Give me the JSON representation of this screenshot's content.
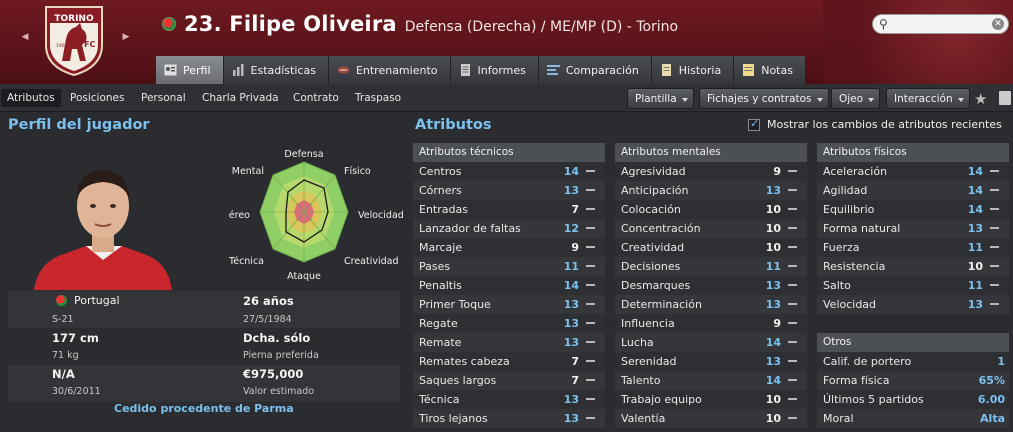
{
  "header": {
    "player_name": "23. Filipe Oliveira",
    "player_role": "Defensa (Derecha) / ME/MP (D) - Torino",
    "crest_name": "TORINO",
    "crest_letters": "FC",
    "crest_year": "1906",
    "search_placeholder": ""
  },
  "tabs": [
    {
      "label": "Perfil",
      "icon": "profile-icon"
    },
    {
      "label": "Estadísticas",
      "icon": "stats-icon"
    },
    {
      "label": "Entrenamiento",
      "icon": "ball-icon"
    },
    {
      "label": "Informes",
      "icon": "report-icon"
    },
    {
      "label": "Comparación",
      "icon": "compare-icon"
    },
    {
      "label": "Historia",
      "icon": "history-icon"
    },
    {
      "label": "Notas",
      "icon": "notes-icon"
    }
  ],
  "subtabs": [
    "Atributos",
    "Posiciones",
    "Personal",
    "Charla Privada",
    "Contrato",
    "Traspaso"
  ],
  "dropdowns": [
    "Plantilla",
    "Fichajes y contratos",
    "Ojeo",
    "Interacción"
  ],
  "profile": {
    "title": "Perfil del jugador",
    "radar_labels": {
      "defensa": "Defensa",
      "fisico": "Físico",
      "velocidad": "Velocidad",
      "creatividad": "Creatividad",
      "ataque": "Ataque",
      "tecnica": "Técnica",
      "juego_aereo": "Juego aéreo",
      "mental": "Mental"
    },
    "nationality": "Portugal",
    "age": "26 años",
    "youth": "S-21",
    "dob": "27/5/1984",
    "height": "177 cm",
    "foot": "Dcha. sólo",
    "weight": "71 kg",
    "foot_label": "Pierna preferida",
    "contract": "N/A",
    "value": "€975,000",
    "contract_date": "30/6/2011",
    "value_label": "Valor estimado",
    "loan": "Cedido procedente de Parma"
  },
  "attributes": {
    "title": "Atributos",
    "show_changes": "Mostrar los cambios de atributos recientes",
    "technical": {
      "title": "Atributos técnicos",
      "items": [
        {
          "name": "Centros",
          "value": "14"
        },
        {
          "name": "Córners",
          "value": "13"
        },
        {
          "name": "Entradas",
          "value": "7"
        },
        {
          "name": "Lanzador de faltas",
          "value": "12"
        },
        {
          "name": "Marcaje",
          "value": "9"
        },
        {
          "name": "Pases",
          "value": "11"
        },
        {
          "name": "Penaltis",
          "value": "14"
        },
        {
          "name": "Primer Toque",
          "value": "13"
        },
        {
          "name": "Regate",
          "value": "13"
        },
        {
          "name": "Remate",
          "value": "13"
        },
        {
          "name": "Remates cabeza",
          "value": "7"
        },
        {
          "name": "Saques largos",
          "value": "7"
        },
        {
          "name": "Técnica",
          "value": "13"
        },
        {
          "name": "Tiros lejanos",
          "value": "13"
        }
      ]
    },
    "mental": {
      "title": "Atributos mentales",
      "items": [
        {
          "name": "Agresividad",
          "value": "9"
        },
        {
          "name": "Anticipación",
          "value": "13"
        },
        {
          "name": "Colocación",
          "value": "10"
        },
        {
          "name": "Concentración",
          "value": "10"
        },
        {
          "name": "Creatividad",
          "value": "10"
        },
        {
          "name": "Decisiones",
          "value": "11"
        },
        {
          "name": "Desmarques",
          "value": "13"
        },
        {
          "name": "Determinación",
          "value": "13"
        },
        {
          "name": "Influencia",
          "value": "9"
        },
        {
          "name": "Lucha",
          "value": "14"
        },
        {
          "name": "Serenidad",
          "value": "13"
        },
        {
          "name": "Talento",
          "value": "14"
        },
        {
          "name": "Trabajo equipo",
          "value": "10"
        },
        {
          "name": "Valentía",
          "value": "10"
        }
      ]
    },
    "physical": {
      "title": "Atributos físicos",
      "items": [
        {
          "name": "Aceleración",
          "value": "14"
        },
        {
          "name": "Agilidad",
          "value": "14"
        },
        {
          "name": "Equilibrio",
          "value": "14"
        },
        {
          "name": "Forma natural",
          "value": "13"
        },
        {
          "name": "Fuerza",
          "value": "11"
        },
        {
          "name": "Resistencia",
          "value": "10"
        },
        {
          "name": "Salto",
          "value": "11"
        },
        {
          "name": "Velocidad",
          "value": "13"
        }
      ]
    },
    "other": {
      "title": "Otros",
      "items": [
        {
          "name": "Calif. de portero",
          "value": "1"
        },
        {
          "name": "Forma física",
          "value": "65%"
        },
        {
          "name": "Últimos 5 partidos",
          "value": "6.00"
        },
        {
          "name": "Moral",
          "value": "Alta"
        }
      ]
    }
  },
  "colors": {
    "header_bg": "#6e1a20",
    "accent_blue": "#7cc1ee",
    "panel_bg": "#2a2c30",
    "radar_outer": "#8fcf66",
    "radar_mid": "#d9c65a",
    "radar_inner": "#e06a7a"
  }
}
